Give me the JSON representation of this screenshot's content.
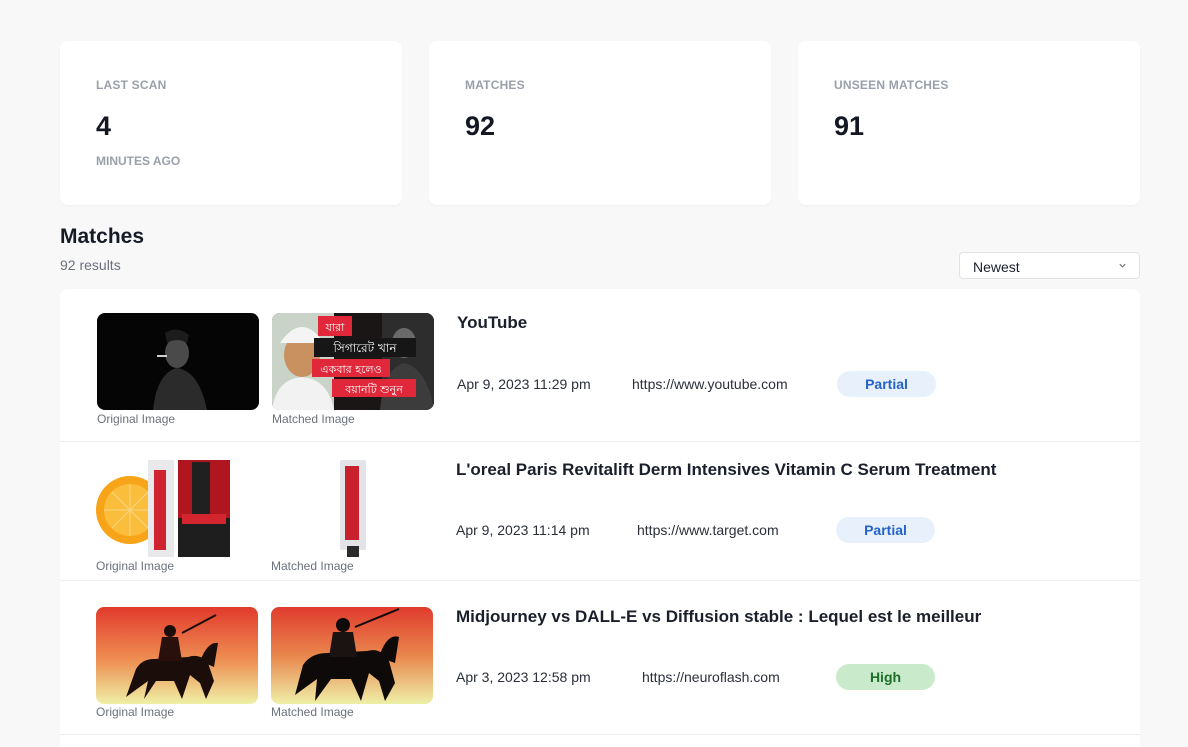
{
  "stats": {
    "last_scan": {
      "label": "LAST SCAN",
      "value": "4",
      "sub": "MINUTES AGO"
    },
    "matches": {
      "label": "MATCHES",
      "value": "92"
    },
    "unseen": {
      "label": "UNSEEN MATCHES",
      "value": "91"
    }
  },
  "section": {
    "title": "Matches",
    "result_count": "92 results",
    "sort": {
      "selected": "Newest",
      "icon": "chevron-down-icon"
    }
  },
  "matches": [
    {
      "original_caption": "Original Image",
      "matched_caption": "Matched Image",
      "title": "YouTube",
      "date": "Apr 9, 2023 11:29 pm",
      "url": "https://www.youtube.com",
      "badge": "Partial",
      "badge_color": "#2463c9",
      "matched_image_text": [
        "যারা",
        "সিগারেট খান",
        "একবার হলেও",
        "বয়ানটি শুনুন"
      ]
    },
    {
      "original_caption": "Original Image",
      "matched_caption": "Matched Image",
      "title": "L'oreal Paris Revitalift Derm Intensives Vitamin C Serum Treatment",
      "date": "Apr 9, 2023 11:14 pm",
      "url": "https://www.target.com",
      "badge": "Partial",
      "badge_color": "#2463c9"
    },
    {
      "original_caption": "Original Image",
      "matched_caption": "Matched Image",
      "title": "Midjourney vs DALL-E vs Diffusion stable : Lequel est le meilleur",
      "date": "Apr 3, 2023 12:58 pm",
      "url": "https://neuroflash.com",
      "badge": "High",
      "badge_color": "#1e6d28"
    }
  ]
}
